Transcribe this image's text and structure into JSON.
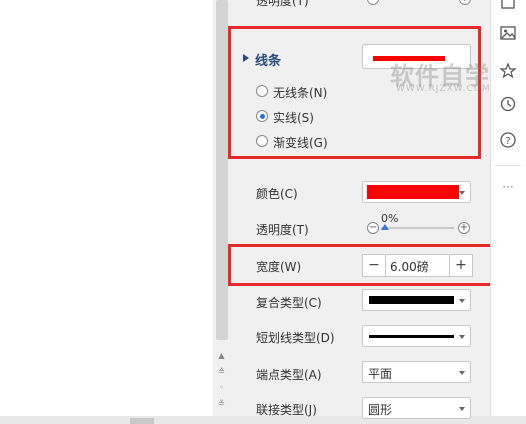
{
  "top_clipped_label": "透明度(T)",
  "line_section": {
    "title": "线条",
    "options": [
      {
        "label": "无线条(N)",
        "selected": false
      },
      {
        "label": "实线(S)",
        "selected": true
      },
      {
        "label": "渐变线(G)",
        "selected": false
      }
    ]
  },
  "color": {
    "label": "颜色(C)",
    "value_color": "#ff0000"
  },
  "transparency": {
    "label": "透明度(T)",
    "value": "0%",
    "value_fraction": 0.0
  },
  "width": {
    "label": "宽度(W)",
    "value": "6.00磅",
    "minus": "−",
    "plus": "+"
  },
  "compound_type": {
    "label": "复合类型(C)"
  },
  "dash_type": {
    "label": "短划线类型(D)"
  },
  "cap_type": {
    "label": "端点类型(A)",
    "value": "平面"
  },
  "join_type": {
    "label": "联接类型(J)",
    "value": "圆形"
  },
  "watermark": {
    "main": "软件自学网",
    "sub": "WWW.RJZXW.COM"
  },
  "rail_icons": [
    "fill-icon",
    "image-icon",
    "star-icon",
    "history-icon",
    "help-icon",
    "more-icon"
  ],
  "accent_red": "#e82a2a"
}
